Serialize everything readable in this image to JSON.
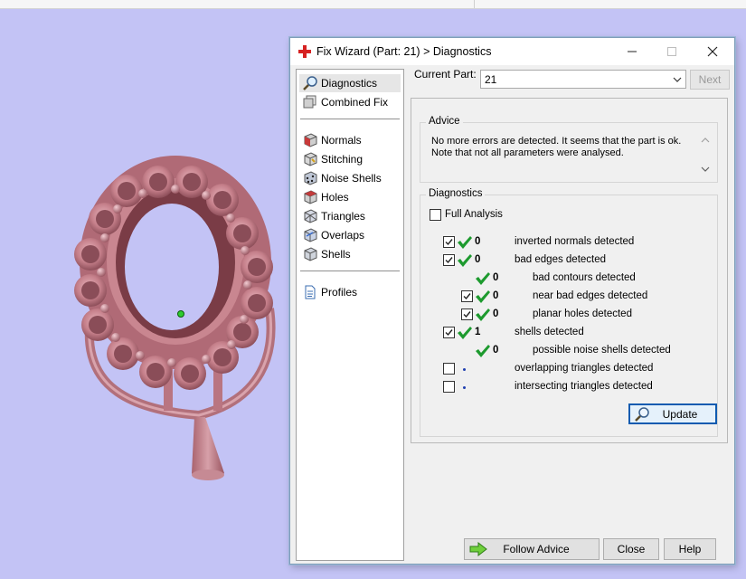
{
  "window": {
    "title": "Fix Wizard (Part: 21) > Diagnostics"
  },
  "nav": {
    "items": [
      {
        "label": "Diagnostics",
        "icon": "magnifier-icon",
        "selected": true
      },
      {
        "label": "Combined Fix",
        "icon": "combined-fix-icon"
      },
      {
        "label": "Normals",
        "icon": "normals-cube-icon"
      },
      {
        "label": "Stitching",
        "icon": "stitching-cube-icon"
      },
      {
        "label": "Noise Shells",
        "icon": "noise-shells-cube-icon"
      },
      {
        "label": "Holes",
        "icon": "holes-cube-icon"
      },
      {
        "label": "Triangles",
        "icon": "triangles-cube-icon"
      },
      {
        "label": "Overlaps",
        "icon": "overlaps-cube-icon"
      },
      {
        "label": "Shells",
        "icon": "shells-cube-icon"
      },
      {
        "label": "Profiles",
        "icon": "document-icon"
      }
    ]
  },
  "current_part": {
    "label": "Current Part:",
    "value": "21",
    "next_label": "Next"
  },
  "advice": {
    "title": "Advice",
    "text": "No more errors are detected. It seems that the part is ok. Note that not all parameters were analysed."
  },
  "diagnostics": {
    "title": "Diagnostics",
    "full_analysis_label": "Full Analysis",
    "full_analysis_checked": false,
    "rows": [
      {
        "checkbox": true,
        "checked": true,
        "status": "ok",
        "count": "0",
        "label": "inverted normals detected",
        "indent": 0
      },
      {
        "checkbox": true,
        "checked": true,
        "status": "ok",
        "count": "0",
        "label": "bad edges detected",
        "indent": 0
      },
      {
        "checkbox": false,
        "checked": false,
        "status": "ok",
        "count": "0",
        "label": "bad contours detected",
        "indent": 1
      },
      {
        "checkbox": true,
        "checked": true,
        "status": "ok",
        "count": "0",
        "label": "near bad edges detected",
        "indent": 1
      },
      {
        "checkbox": true,
        "checked": true,
        "status": "ok",
        "count": "0",
        "label": "planar holes detected",
        "indent": 1
      },
      {
        "checkbox": true,
        "checked": true,
        "status": "ok",
        "count": "1",
        "label": "shells detected",
        "indent": 0
      },
      {
        "checkbox": false,
        "checked": false,
        "status": "ok",
        "count": "0",
        "label": "possible noise shells detected",
        "indent": 1
      },
      {
        "checkbox": true,
        "checked": false,
        "status": "pending",
        "count": "",
        "label": "overlapping triangles detected",
        "indent": 0
      },
      {
        "checkbox": true,
        "checked": false,
        "status": "pending",
        "count": "",
        "label": "intersecting triangles detected",
        "indent": 0
      }
    ],
    "update_label": "Update"
  },
  "buttons": {
    "follow_advice": "Follow Advice",
    "close": "Close",
    "help": "Help"
  },
  "colors": {
    "viewport_bg": "#c3c3f5",
    "model": "#c9858f",
    "check_green": "#1d9a2e",
    "accent": "#0f5bb0"
  }
}
